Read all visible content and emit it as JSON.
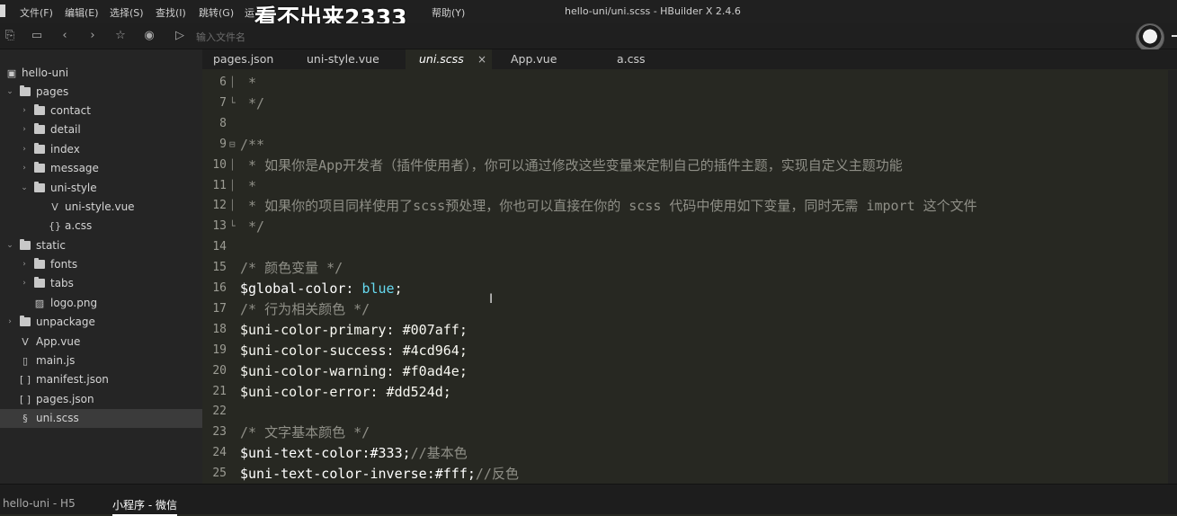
{
  "menubar": {
    "items": [
      "文件(F)",
      "编辑(E)",
      "选择(S)",
      "查找(I)",
      "跳转(G)",
      "运",
      "帮助(Y)"
    ],
    "overlay_text": "看不出来2333",
    "window_title": "hello-uni/uni.scss - HBuilder X 2.4.6"
  },
  "toolbar": {
    "icons": [
      "new-file-icon",
      "save-icon",
      "back-icon",
      "forward-icon",
      "star-icon",
      "run-icon",
      "browser-preview-icon"
    ],
    "path_input_placeholder": "输入文件名"
  },
  "sidebar": {
    "items": [
      {
        "label": "hello-uni",
        "type": "project",
        "expanded": true
      },
      {
        "label": "pages",
        "type": "folder",
        "expanded": true
      },
      {
        "label": "contact",
        "type": "folder",
        "expanded": false
      },
      {
        "label": "detail",
        "type": "folder",
        "expanded": false
      },
      {
        "label": "index",
        "type": "folder",
        "expanded": false
      },
      {
        "label": "message",
        "type": "folder",
        "expanded": false
      },
      {
        "label": "uni-style",
        "type": "folder",
        "expanded": true
      },
      {
        "label": "uni-style.vue",
        "type": "vue-file"
      },
      {
        "label": "a.css",
        "type": "css-file"
      },
      {
        "label": "static",
        "type": "folder",
        "expanded": true
      },
      {
        "label": "fonts",
        "type": "folder",
        "expanded": false
      },
      {
        "label": "tabs",
        "type": "folder",
        "expanded": false
      },
      {
        "label": "logo.png",
        "type": "image-file"
      },
      {
        "label": "unpackage",
        "type": "folder",
        "expanded": false
      },
      {
        "label": "App.vue",
        "type": "vue-file"
      },
      {
        "label": "main.js",
        "type": "js-file"
      },
      {
        "label": "manifest.json",
        "type": "json-file"
      },
      {
        "label": "pages.json",
        "type": "json-file"
      },
      {
        "label": "uni.scss",
        "type": "scss-file",
        "selected": true
      }
    ]
  },
  "tabs": [
    {
      "label": "pages.json",
      "active": false
    },
    {
      "label": "uni-style.vue",
      "active": false
    },
    {
      "label": "uni.scss",
      "active": true,
      "close": "×"
    },
    {
      "label": "App.vue",
      "active": false
    },
    {
      "label": "a.css",
      "active": false
    }
  ],
  "editor": {
    "lines": [
      {
        "n": "6",
        "text": " *",
        "kind": "comment",
        "fold": "│"
      },
      {
        "n": "7",
        "text": " */",
        "kind": "comment",
        "fold": "└"
      },
      {
        "n": "8",
        "text": "",
        "kind": "plain",
        "fold": ""
      },
      {
        "n": "9",
        "text": "/**",
        "kind": "comment",
        "fold": "⊟"
      },
      {
        "n": "10",
        "text": " * 如果你是App开发者（插件使用者），你可以通过修改这些变量来定制自己的插件主题，实现自定义主题功能",
        "kind": "comment",
        "fold": "│"
      },
      {
        "n": "11",
        "text": " *",
        "kind": "comment",
        "fold": "│"
      },
      {
        "n": "12",
        "text": " * 如果你的项目同样使用了scss预处理，你也可以直接在你的 scss 代码中使用如下变量，同时无需 import 这个文件",
        "kind": "comment",
        "fold": "│"
      },
      {
        "n": "13",
        "text": " */",
        "kind": "comment",
        "fold": "└"
      },
      {
        "n": "14",
        "text": "",
        "kind": "plain",
        "fold": ""
      },
      {
        "n": "15",
        "text": "/* 颜色变量 */",
        "kind": "comment",
        "fold": ""
      },
      {
        "n": "16",
        "var": "$global-color: ",
        "value": "blue",
        "rest": ";",
        "kind": "decl",
        "fold": ""
      },
      {
        "n": "17",
        "text": "/* 行为相关颜色 */",
        "kind": "comment",
        "fold": ""
      },
      {
        "n": "18",
        "text": "$uni-color-primary: #007aff;",
        "kind": "plain",
        "fold": ""
      },
      {
        "n": "19",
        "text": "$uni-color-success: #4cd964;",
        "kind": "plain",
        "fold": ""
      },
      {
        "n": "20",
        "text": "$uni-color-warning: #f0ad4e;",
        "kind": "plain",
        "fold": ""
      },
      {
        "n": "21",
        "text": "$uni-color-error: #dd524d;",
        "kind": "plain",
        "fold": ""
      },
      {
        "n": "22",
        "text": "",
        "kind": "plain",
        "fold": ""
      },
      {
        "n": "23",
        "text": "/* 文字基本颜色 */",
        "kind": "comment",
        "fold": ""
      },
      {
        "n": "24",
        "var": "$uni-text-color:#333;",
        "value": "",
        "rest": "//基本色",
        "kind": "decl-comment",
        "fold": ""
      },
      {
        "n": "25",
        "var": "$uni-text-color-inverse:#fff;",
        "value": "",
        "rest": "//反色",
        "kind": "decl-comment",
        "fold": ""
      }
    ]
  },
  "bottombar": {
    "tabs": [
      {
        "label": "hello-uni - H5",
        "active": false
      },
      {
        "label": "小程序 - 微信",
        "active": true
      }
    ]
  },
  "colors": {
    "editor_bg": "#272822",
    "sidebar_bg": "#252525",
    "comment": "#8f8f87",
    "value_keyword": "#66d9ef"
  }
}
